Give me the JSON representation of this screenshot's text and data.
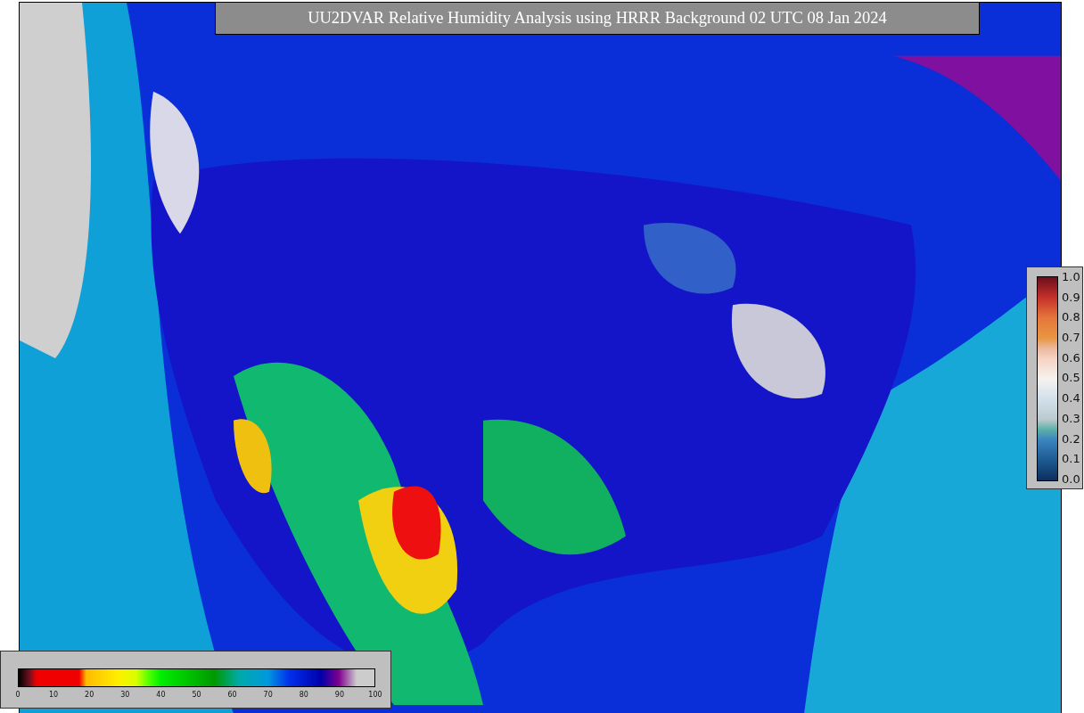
{
  "title": "UU2DVAR Relative Humidity Analysis using HRRR Background 02 UTC 08 Jan 2024",
  "observation_colorbar": {
    "ticks": [
      "1.0",
      "0.9",
      "0.8",
      "0.7",
      "0.6",
      "0.5",
      "0.4",
      "0.3",
      "0.2",
      "0.1",
      "0.0"
    ]
  },
  "humidity_colorbar": {
    "ticks": [
      "0",
      "10",
      "20",
      "30",
      "40",
      "50",
      "60",
      "70",
      "80",
      "90",
      "100"
    ]
  }
}
